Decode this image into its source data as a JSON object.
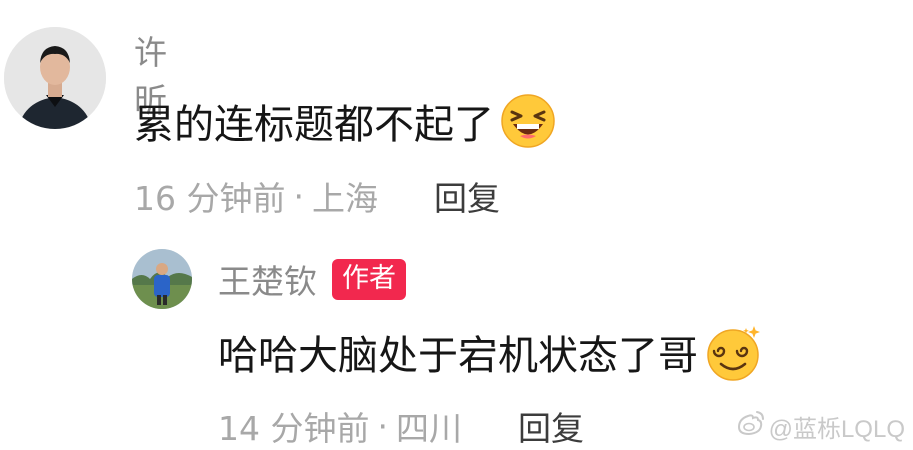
{
  "comments": [
    {
      "username": "许昕",
      "text": "累的连标题都不起了",
      "emoji": "laughing-emoji",
      "time": "16 分钟前",
      "separator": "·",
      "location": "上海",
      "reply_label": "回复"
    },
    {
      "username": "王楚钦",
      "badge": "作者",
      "text": "哈哈大脑处于宕机状态了哥",
      "emoji": "dizzy-emoji",
      "time": "14 分钟前",
      "separator": "·",
      "location": "四川",
      "reply_label": "回复"
    }
  ],
  "watermark": {
    "text": "@蓝栎LQLQ",
    "icon": "weibo-icon"
  },
  "colors": {
    "badge": "#f2284e",
    "username": "#8a8a8a",
    "meta": "#a8a8a8",
    "text": "#161616"
  }
}
